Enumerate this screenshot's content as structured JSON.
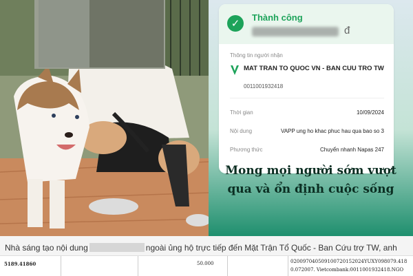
{
  "receipt": {
    "status": "Thành công",
    "currency": "đ",
    "section_label": "Thông tin người nhận",
    "recipient_name": "MAT TRAN TO QUOC VN - BAN CUU TRO TW",
    "account_number": "0011001932418",
    "time_label": "Thời gian",
    "time_value": "10/09/2024",
    "content_label": "Nội dung",
    "content_value": "VAPP ung ho khac phuc hau qua bao so 3",
    "method_label": "Phương thức",
    "method_value": "Chuyển nhanh Napas 247"
  },
  "banner": {
    "line1": "Mong mọi người sớm vượt",
    "line2": "qua và ổn định cuộc sống"
  },
  "caption": {
    "part1": "Nhà sáng tạo nội dung",
    "part2": "ngoài ủng hộ trực tiếp đến Mặt Trận Tổ Quốc - Ban Cứu trợ TW, anh"
  },
  "statement": {
    "col1_line1": "5189.41860",
    "col3_line1": "50.000",
    "col4_line1": "020097040509100720152024YUXY098079.418",
    "col4_line2": "0.072007. Vietcombank:0011001932418.NGO"
  },
  "colors": {
    "success": "#1da35a",
    "banner_text": "#0b2e22"
  }
}
